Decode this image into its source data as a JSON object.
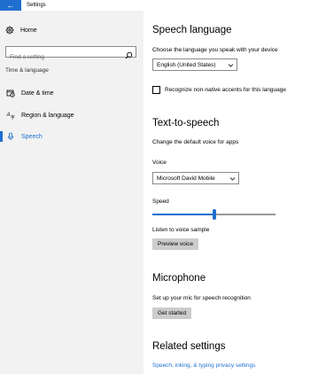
{
  "window": {
    "title": "Settings",
    "back_glyph": "←"
  },
  "sidebar": {
    "home_label": "Home",
    "search_placeholder": "Find a setting",
    "section_label": "Time & language",
    "items": [
      {
        "label": "Date & time",
        "icon": "date-time-icon"
      },
      {
        "label": "Region & language",
        "icon": "region-language-icon"
      },
      {
        "label": "Speech",
        "icon": "microphone-icon",
        "selected": true
      }
    ]
  },
  "speech_language": {
    "heading": "Speech language",
    "description": "Choose the language you speak with your device",
    "selected_language": "English (United States)",
    "checkbox_label": "Recognize non-native accents for this language",
    "checkbox_checked": false
  },
  "tts": {
    "heading": "Text-to-speech",
    "description": "Change the default voice for apps",
    "voice_label": "Voice",
    "voice_value": "Microsoft David Mobile",
    "speed_label": "Speed",
    "speed_fraction": 0.5,
    "sample_label": "Listen to voice sample",
    "preview_button": "Preview voice"
  },
  "microphone": {
    "heading": "Microphone",
    "description": "Set up your mic for speech recognition",
    "button": "Get started"
  },
  "related": {
    "heading": "Related settings",
    "link": "Speech, inking, & typing privacy settings"
  },
  "colors": {
    "accent": "#1f6fcf",
    "sidebar_bg": "#f2f2f2",
    "button_bg": "#cccccc"
  }
}
